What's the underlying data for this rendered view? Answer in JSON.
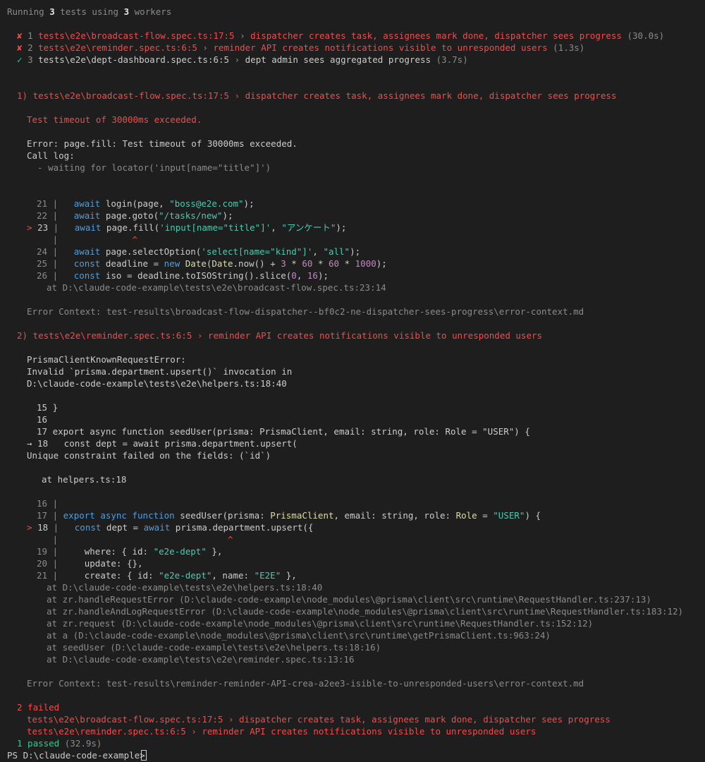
{
  "terminal": {
    "running": {
      "pre": "Running ",
      "count": "3",
      "mid": " tests using ",
      "workers": "3",
      "post": " workers"
    },
    "results": [
      {
        "mark": "✘",
        "idx": "1",
        "file": "tests\\e2e\\broadcast-flow.spec.ts:17:5",
        "sep": " › ",
        "title": "dispatcher creates task, assignees mark done, dispatcher sees progress",
        "dur": "(30.0s)"
      },
      {
        "mark": "✘",
        "idx": "2",
        "file": "tests\\e2e\\reminder.spec.ts:6:5",
        "sep": " › ",
        "title": "reminder API creates notifications visible to unresponded users",
        "dur": "(1.3s)"
      },
      {
        "mark": "✓",
        "idx": "3",
        "file": "tests\\e2e\\dept-dashboard.spec.ts:6:5",
        "sep": " › ",
        "title": "dept admin sees aggregated progress",
        "dur": "(3.7s)"
      }
    ],
    "fail1": {
      "header": "1) tests\\e2e\\broadcast-flow.spec.ts:17:5 › dispatcher creates task, assignees mark done, dispatcher sees progress",
      "timeout": "Test timeout of 30000ms exceeded.",
      "error": "Error: page.fill: Test timeout of 30000ms exceeded.",
      "calllog": "Call log:",
      "waiting": "  - waiting for locator('input[name=\"title\"]')",
      "code": {
        "l21": {
          "num": "21",
          "a": "await",
          "b": " login(page, ",
          "c": "\"boss@e2e.com\"",
          "d": ");"
        },
        "l22": {
          "num": "22",
          "a": "await",
          "b": " page.goto(",
          "c": "\"/tasks/new\"",
          "d": ");"
        },
        "l23": {
          "arrow": ">",
          "num": "23",
          "a": "await",
          "b": " page.fill(",
          "c": "'input[name=\"title\"]'",
          "d": ", ",
          "e": "\"アンケート\"",
          "f": ");"
        },
        "caret": "^",
        "l24": {
          "num": "24",
          "a": "await",
          "b": " page.selectOption(",
          "c": "'select[name=\"kind\"]'",
          "d": ", ",
          "e": "\"all\"",
          "f": ");"
        },
        "l25": {
          "num": "25",
          "a": "const",
          "b": " deadline = ",
          "c": "new",
          "d": " ",
          "e": "Date",
          "f": "(",
          "g": "Date",
          "h": ".now() + ",
          "i": "3",
          "j": " * ",
          "k": "60",
          "l": " * ",
          "m": "60",
          "n": " * ",
          "o": "1000",
          "p": ");"
        },
        "l26": {
          "num": "26",
          "a": "const",
          "b": " iso = deadline.toISOString().slice(",
          "c": "0",
          "d": ", ",
          "e": "16",
          "f": ");"
        }
      },
      "at": "at D:\\claude-code-example\\tests\\e2e\\broadcast-flow.spec.ts:23:14",
      "context": "Error Context: test-results\\broadcast-flow-dispatcher--bf0c2-ne-dispatcher-sees-progress\\error-context.md"
    },
    "fail2": {
      "header": "2) tests\\e2e\\reminder.spec.ts:6:5 › reminder API creates notifications visible to unresponded users",
      "e1": "PrismaClientKnownRequestError:",
      "e2": "Invalid `prisma.department.upsert()` invocation in",
      "e3": "D:\\claude-code-example\\tests\\e2e\\helpers.ts:18:40",
      "s15": "15 }",
      "s16": "16",
      "s17": "17 export async function seedUser(prisma: PrismaClient, email: string, role: Role = \"USER\") {",
      "s18": "→ 18   const dept = await prisma.department.upsert(",
      "unique": "Unique constraint failed on the fields: (`id`)",
      "athelpers": "at helpers.ts:18",
      "code": {
        "l16": {
          "num": "16"
        },
        "l17": {
          "num": "17",
          "a": "export",
          "b": " ",
          "c": "async",
          "d": " ",
          "e": "function",
          "f": " seedUser(prisma: ",
          "g": "PrismaClient",
          "h": ", email: string, role: ",
          "i": "Role",
          "j": " = ",
          "k": "\"USER\"",
          "l": ") {"
        },
        "l18": {
          "arrow": ">",
          "num": "18",
          "a": "const",
          "b": " dept = ",
          "c": "await",
          "d": " prisma.department.upsert({"
        },
        "caret": "^",
        "l19": {
          "num": "19",
          "a": "where: { id: ",
          "b": "\"e2e-dept\"",
          "c": " },"
        },
        "l20": {
          "num": "20",
          "a": "update: {},"
        },
        "l21": {
          "num": "21",
          "a": "create: { id: ",
          "b": "\"e2e-dept\"",
          "c": ", name: ",
          "d": "\"E2E\"",
          "e": " },"
        }
      },
      "stack": [
        "at D:\\claude-code-example\\tests\\e2e\\helpers.ts:18:40",
        "at zr.handleRequestError (D:\\claude-code-example\\node_modules\\@prisma\\client\\src\\runtime\\RequestHandler.ts:237:13)",
        "at zr.handleAndLogRequestError (D:\\claude-code-example\\node_modules\\@prisma\\client\\src\\runtime\\RequestHandler.ts:183:12)",
        "at zr.request (D:\\claude-code-example\\node_modules\\@prisma\\client\\src\\runtime\\RequestHandler.ts:152:12)",
        "at a (D:\\claude-code-example\\node_modules\\@prisma\\client\\src\\runtime\\getPrismaClient.ts:963:24)",
        "at seedUser (D:\\claude-code-example\\tests\\e2e\\helpers.ts:18:16)",
        "at D:\\claude-code-example\\tests\\e2e\\reminder.spec.ts:13:16"
      ],
      "context": "Error Context: test-results\\reminder-reminder-API-crea-a2ee3-isible-to-unresponded-users\\error-context.md"
    },
    "summary": {
      "failed": "2 failed",
      "f1": "tests\\e2e\\broadcast-flow.spec.ts:17:5 › dispatcher creates task, assignees mark done, dispatcher sees progress",
      "f2": "tests\\e2e\\reminder.spec.ts:6:5 › reminder API creates notifications visible to unresponded users",
      "passed": "1 passed",
      "passed_dur": "(32.9s)"
    },
    "prompt": "PS D:\\claude-code-example> "
  },
  "colors": {
    "background": "#1e1e1e",
    "text": "#cccccc",
    "error": "#f14c4c",
    "success": "#23d18b",
    "dim": "#8b8b8b",
    "keyword": "#569cd6",
    "string": "#4ec9b0",
    "number": "#c586c0",
    "type": "#dcdcaa"
  }
}
